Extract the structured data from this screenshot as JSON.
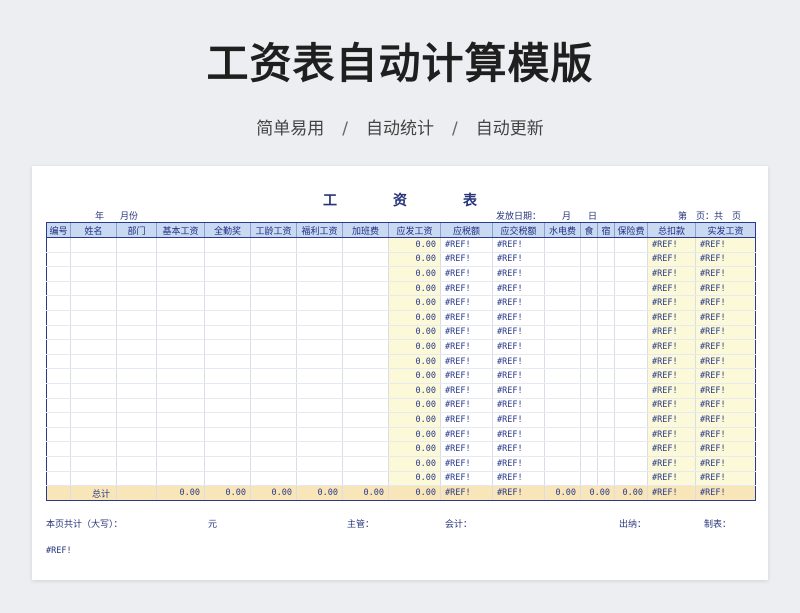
{
  "title": "工资表自动计算模版",
  "subtitle": {
    "items": [
      "简单易用",
      "自动统计",
      "自动更新"
    ],
    "separator": "/"
  },
  "sheet": {
    "title_chars": [
      "工",
      "资",
      "表"
    ],
    "meta": {
      "year": "年",
      "month": "月份",
      "issue_date": "发放日期：",
      "issue_month": "月",
      "issue_day": "日",
      "page_no": "第　页：共　页"
    },
    "columns": [
      "编号",
      "姓名",
      "部门",
      "基本工资",
      "全勤奖",
      "工龄工资",
      "福利工资",
      "加班费",
      "应发工资",
      "应税额",
      "应交税额",
      "水电费",
      "食",
      "宿",
      "保险费",
      "总扣款",
      "实发工资"
    ],
    "row_values": {
      "gross": "0.00",
      "ref": "#REF!"
    },
    "row_count": 17,
    "total": {
      "label": "总计",
      "base": "0.00",
      "attendance": "0.00",
      "seniority": "0.00",
      "welfare": "0.00",
      "overtime": "0.00",
      "gross": "0.00",
      "taxable": "#REF!",
      "tax": "#REF!",
      "utility": "0.00",
      "food": "0.00",
      "insurance": "0.00",
      "deduction": "#REF!",
      "net": "#REF!"
    },
    "footer": {
      "page_total": "本页共计（大写）：",
      "yuan": "元",
      "supervisor": "主管：",
      "accountant": "会计：",
      "cashier": "出纳：",
      "preparer": "制表："
    },
    "ref_note": "#REF!"
  },
  "colors": {
    "header_bg": "#c9d9f2",
    "border": "#2a3a8a",
    "highlight": "#fbf9d8",
    "total_bg": "#f8e6b8"
  }
}
